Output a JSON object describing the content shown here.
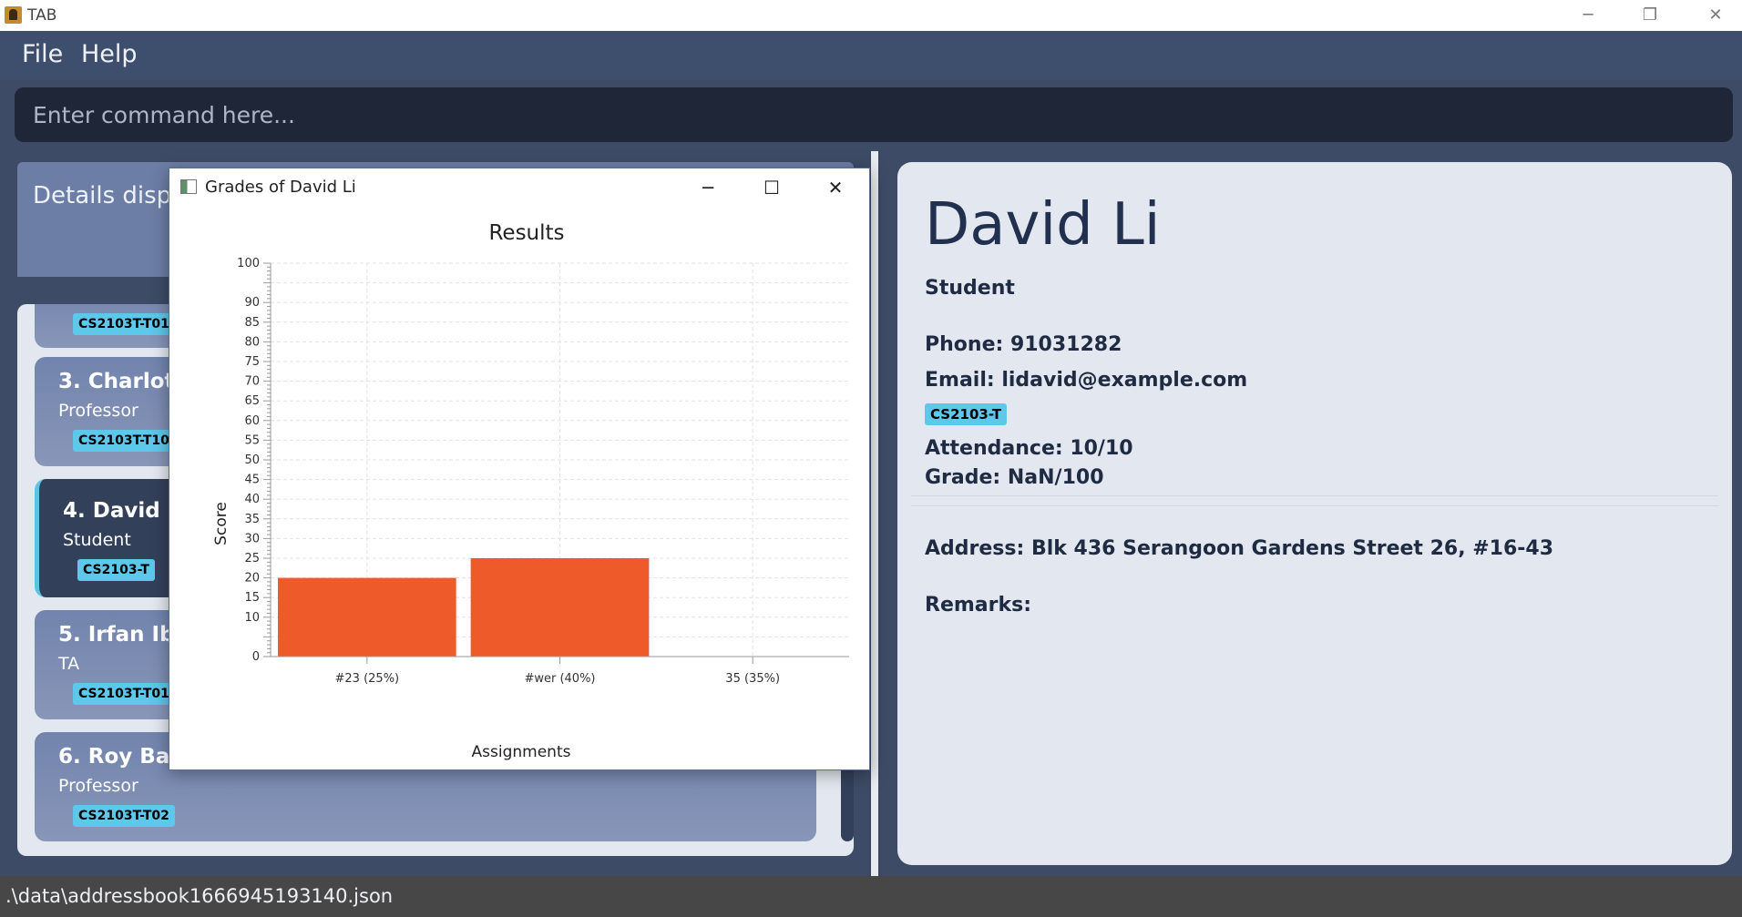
{
  "window": {
    "title": "TAB",
    "minimize": "─",
    "maximize": "❐",
    "close": "✕"
  },
  "menu": {
    "file": "File",
    "help": "Help"
  },
  "command": {
    "placeholder": "Enter command here..."
  },
  "details_display": {
    "text": "Details display"
  },
  "persons": [
    {
      "name": "",
      "role": "",
      "tag": "CS2103T-T01"
    },
    {
      "name": "3.  Charlotte",
      "role": "Professor",
      "tag": "CS2103T-T10"
    },
    {
      "name": "4.  David Li",
      "role": "Student",
      "tag": "CS2103-T"
    },
    {
      "name": "5.  Irfan Ibrahim",
      "role": "TA",
      "tag": "CS2103T-T01"
    },
    {
      "name": "6.  Roy Balakrishnan",
      "role": "Professor",
      "tag": "CS2103T-T02"
    }
  ],
  "detail": {
    "name": "David Li",
    "role": "Student",
    "phone": "Phone: 91031282",
    "email": "Email: lidavid@example.com",
    "tag": "CS2103-T",
    "attendance": "Attendance: 10/10",
    "grade": "Grade: NaN/100",
    "address": "Address: Blk 436 Serangoon Gardens Street 26, #16-43",
    "remarks": "Remarks:"
  },
  "status": {
    "path": ".\\data\\addressbook1666945193140.json"
  },
  "chart_window": {
    "title": "Grades of David Li",
    "minimize": "─",
    "maximize": "☐",
    "close": "✕"
  },
  "colors": {
    "bar": "#ee5a2a",
    "tag": "#5dc8ea",
    "selected_border": "#5dc2e6"
  },
  "chart_data": {
    "type": "bar",
    "title": "Results",
    "xlabel": "Assignments",
    "ylabel": "Score",
    "categories": [
      "#23 (25%)",
      "#wer (40%)",
      "35 (35%)"
    ],
    "values": [
      20,
      25,
      0
    ],
    "ylim": [
      0,
      100
    ],
    "yticks": [
      0,
      10,
      15,
      20,
      25,
      30,
      35,
      40,
      45,
      50,
      55,
      60,
      65,
      70,
      75,
      80,
      85,
      90,
      100
    ],
    "grid": true,
    "legend": "none"
  }
}
